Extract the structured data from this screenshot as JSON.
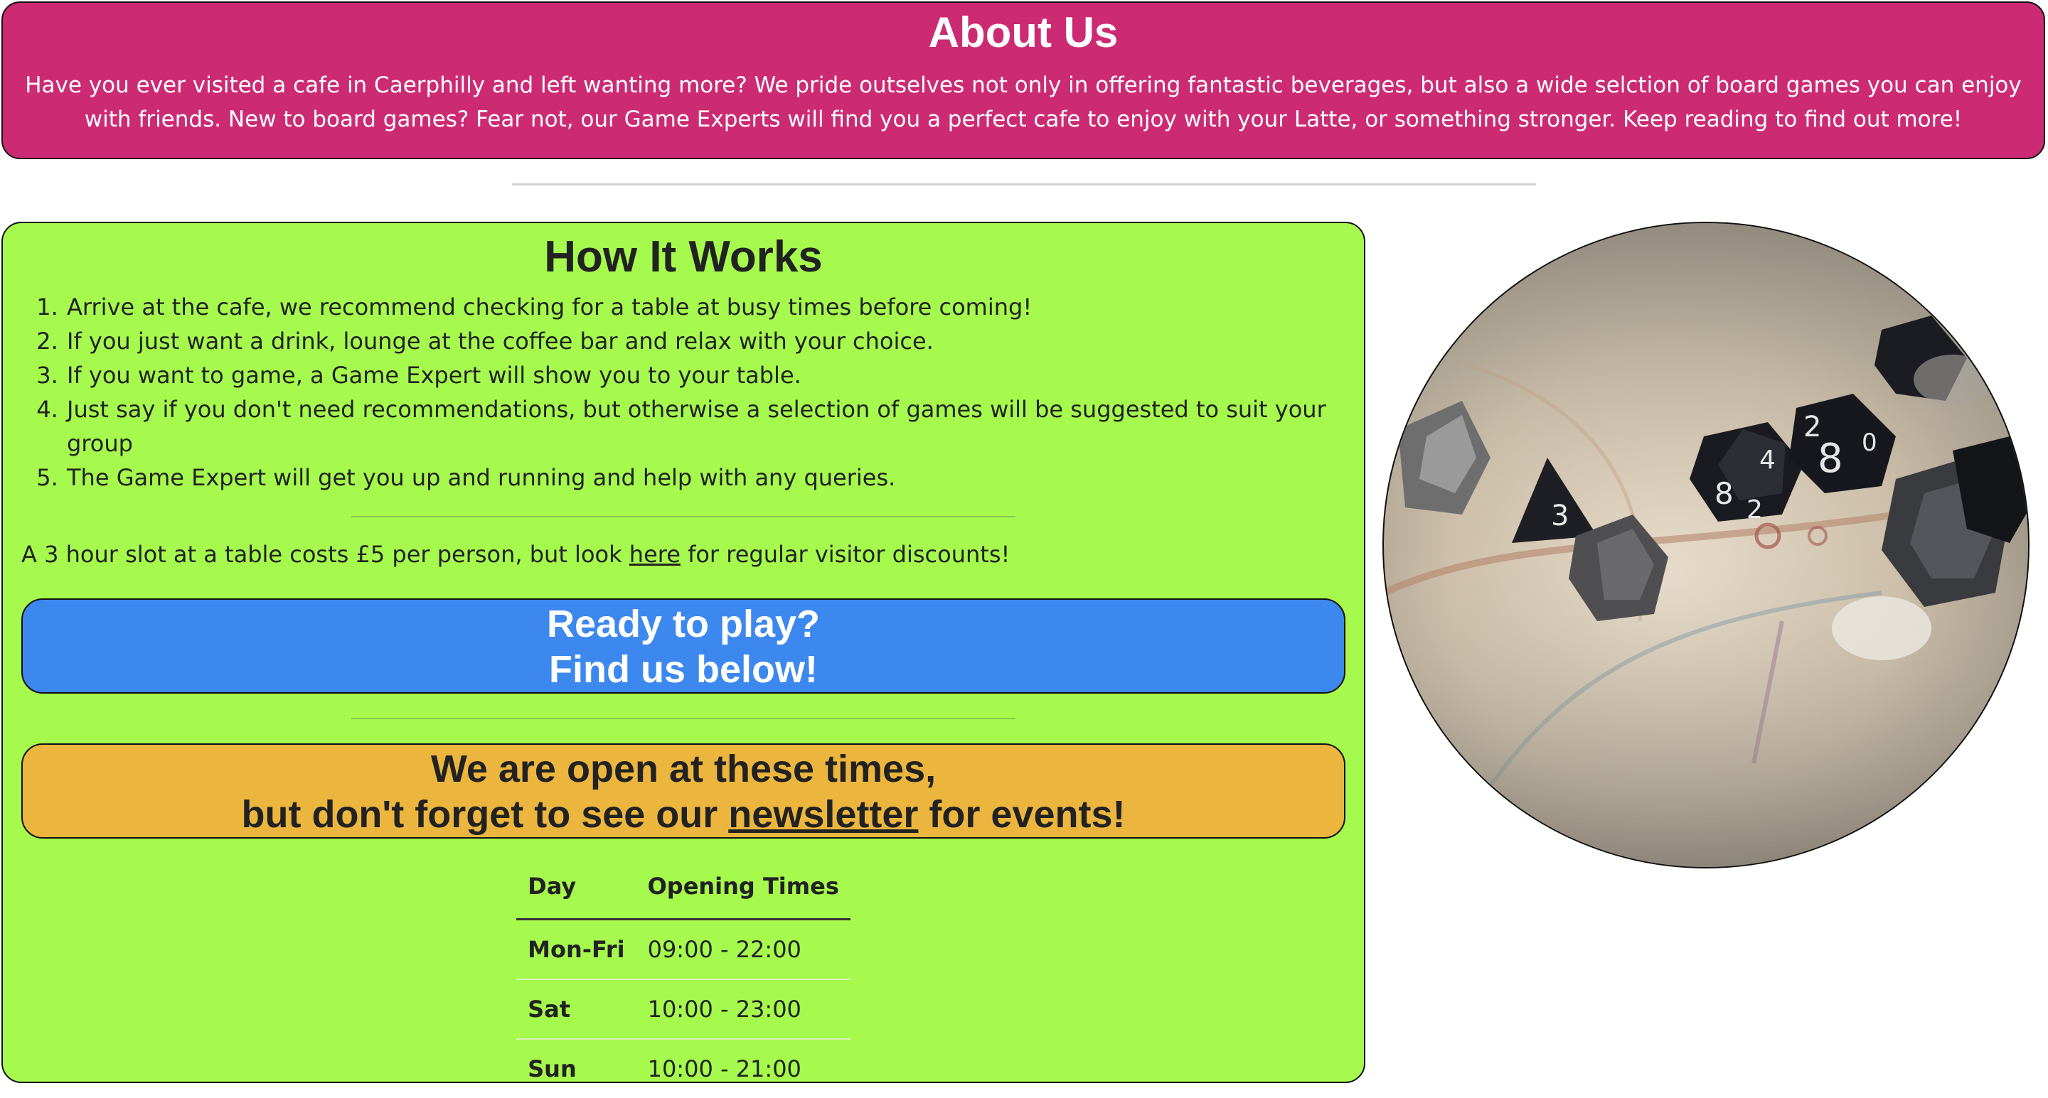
{
  "about": {
    "title": "About Us",
    "text": "Have you ever visited a cafe in Caerphilly and left wanting more? We pride outselves not only in offering fantastic beverages, but also a wide selction of board games you can enjoy with friends. New to board games? Fear not, our Game Experts will find you a perfect cafe to enjoy with your Latte, or something stronger. Keep reading to find out more!"
  },
  "how": {
    "title": "How It Works",
    "steps": [
      "Arrive at the cafe, we recommend checking for a table at busy times before coming!",
      "If you just want a drink, lounge at the coffee bar and relax with your choice.",
      "If you want to game, a Game Expert will show you to your table.",
      "Just say if you don't need recommendations, but otherwise a selection of games will be suggested to suit your group",
      "The Game Expert will get you up and running and help with any queries."
    ],
    "price_before": "A 3 hour slot at a table costs £5 per person, but look ",
    "price_link": "here",
    "price_after": " for regular visitor discounts!"
  },
  "ready": {
    "line1": "Ready to play?",
    "line2": "Find us below!"
  },
  "open": {
    "line1": "We are open at these times,",
    "line2_before": "but don't forget to see our ",
    "line2_link": "newsletter",
    "line2_after": " for events!"
  },
  "hours": {
    "headers": [
      "Day",
      "Opening Times"
    ],
    "rows": [
      {
        "day": "Mon-Fri",
        "time": "09:00 - 22:00"
      },
      {
        "day": "Sat",
        "time": "10:00 - 23:00"
      },
      {
        "day": "Sun",
        "time": "10:00 - 21:00"
      }
    ]
  },
  "image": {
    "icon": "dice-on-map-photo",
    "dice_numbers": [
      "8",
      "2",
      "4",
      "8",
      "2",
      "3",
      "0"
    ]
  },
  "colors": {
    "about_bg": "#cc2b73",
    "how_bg": "#a6f94d",
    "ready_bg": "#3c88ee",
    "open_bg": "#ecb63e"
  }
}
